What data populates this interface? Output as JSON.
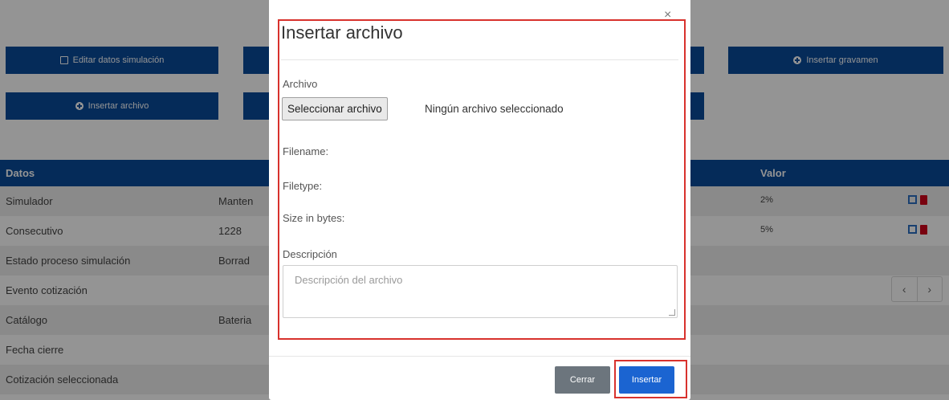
{
  "background": {
    "buttons": {
      "edit_simulation": "Editar datos simulación",
      "insert_tax": "Insertar gravamen",
      "insert_file": "Insertar archivo"
    },
    "table": {
      "headers": {
        "datos": "Datos",
        "valor": "Valor"
      },
      "rows": [
        {
          "label": "Simulador",
          "value": "Manten"
        },
        {
          "label": "Consecutivo",
          "value": "1228"
        },
        {
          "label": "Estado proceso simulación",
          "value": "Borrad"
        },
        {
          "label": "Evento cotización",
          "value": ""
        },
        {
          "label": "Catálogo",
          "value": "Bateria"
        },
        {
          "label": "Fecha cierre",
          "value": ""
        },
        {
          "label": "Cotización seleccionada",
          "value": ""
        }
      ],
      "values_column": [
        "2%",
        "5%"
      ]
    },
    "pager": {
      "prev": "‹",
      "next": "›"
    }
  },
  "modal": {
    "title": "Insertar archivo",
    "close_glyph": "×",
    "file_label": "Archivo",
    "file_button": "Seleccionar archivo",
    "file_status": "Ningún archivo seleccionado",
    "filename_label": "Filename:",
    "filetype_label": "Filetype:",
    "size_label": "Size in bytes:",
    "description_label": "Descripción",
    "description_placeholder": "Descripción del archivo",
    "close_button": "Cerrar",
    "insert_button": "Insertar"
  },
  "colors": {
    "primary": "#0a4a9a",
    "insert_button": "#1b64d1",
    "close_button": "#6c757d",
    "highlight": "#d8322d",
    "delete_icon": "#d0021b"
  },
  "icons": [
    "edit-icon",
    "plus-circle-icon",
    "trash-icon",
    "close-icon",
    "chevron-left-icon",
    "chevron-right-icon"
  ]
}
